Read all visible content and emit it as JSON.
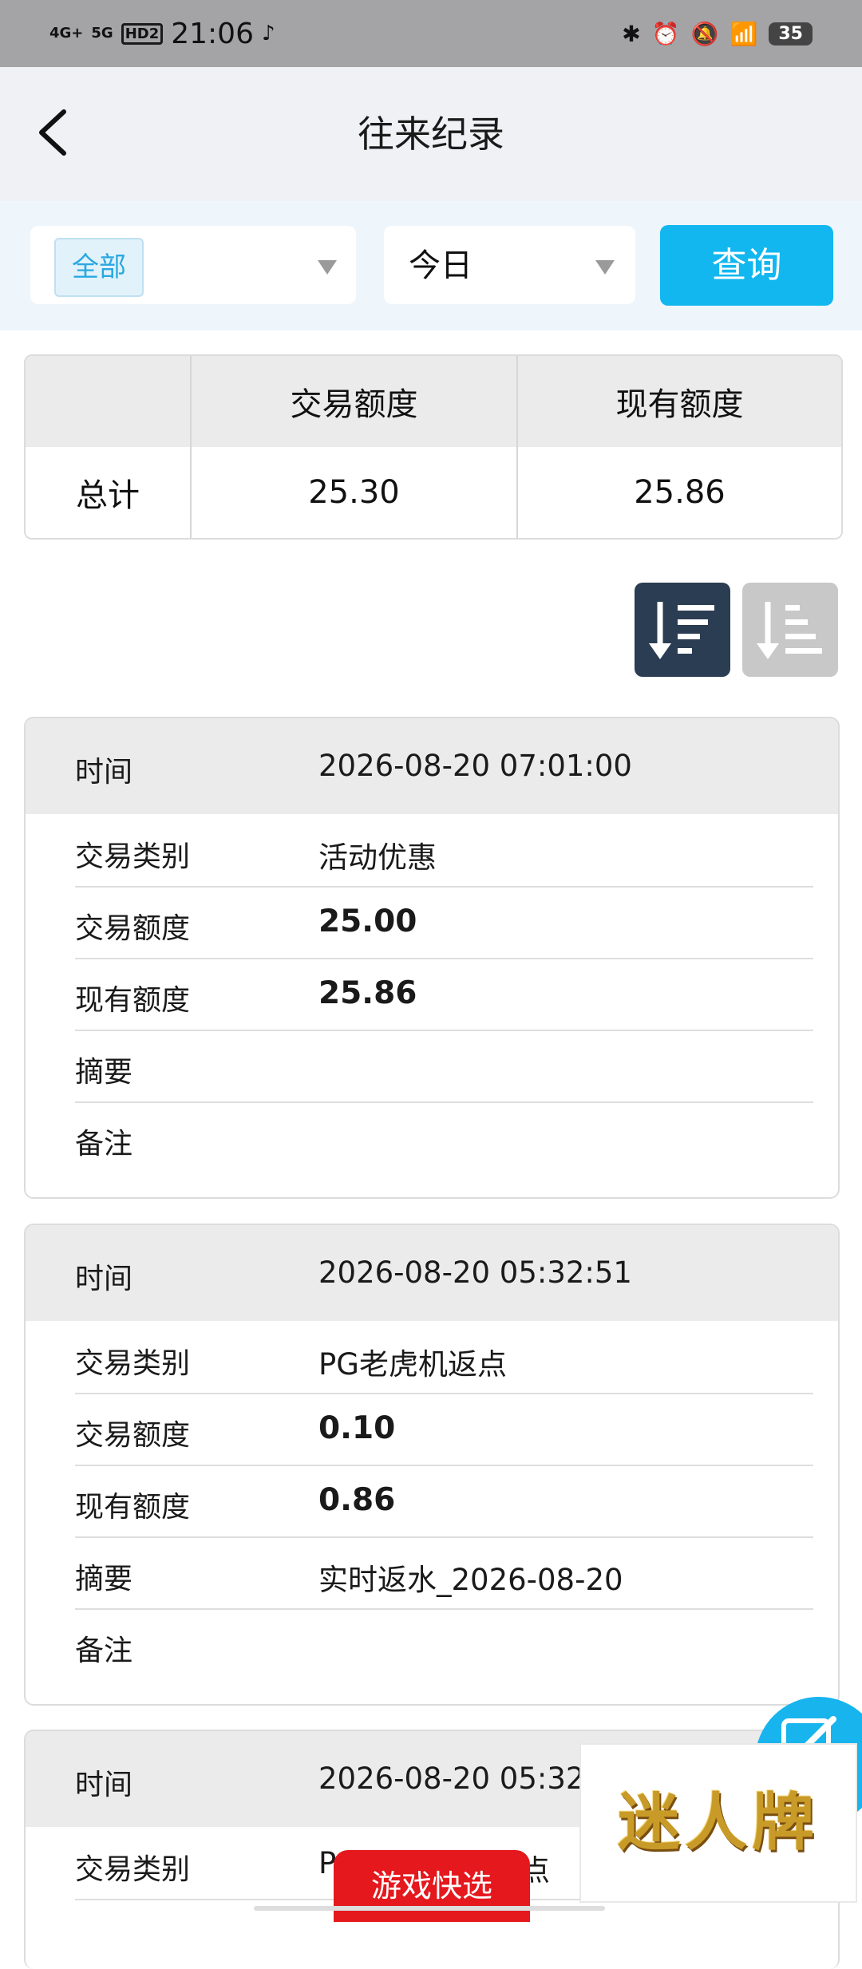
{
  "status_bar": {
    "signal_1": "4G+",
    "signal_2": "5G",
    "hd": "HD2",
    "time": "21:06",
    "battery": "35"
  },
  "header": {
    "title": "往来纪录",
    "back_icon": "chevron-left-icon"
  },
  "filters": {
    "type_selected": "全部",
    "period_selected": "今日",
    "query_label": "查询"
  },
  "summary": {
    "col_amount": "交易额度",
    "col_balance": "现有额度",
    "row_label": "总计",
    "total_amount": "25.30",
    "total_balance": "25.86"
  },
  "sort_buttons": {
    "desc_icon": "sort-descending-icon",
    "asc_icon": "sort-ascending-icon"
  },
  "labels": {
    "time": "时间",
    "type": "交易类别",
    "amount": "交易额度",
    "balance": "现有额度",
    "summary": "摘要",
    "note": "备注"
  },
  "records": [
    {
      "time": "2026-08-20 07:01:00",
      "type": "活动优惠",
      "amount": "25.00",
      "balance": "25.86",
      "summary": "",
      "note": ""
    },
    {
      "time": "2026-08-20 05:32:51",
      "type": "PG老虎机返点",
      "amount": "0.10",
      "balance": "0.86",
      "summary": "实时返水_2026-08-20",
      "note": ""
    },
    {
      "time": "2026-08-20 05:32",
      "type": "P",
      "type_tail": "点"
    }
  ],
  "overlays": {
    "brand_text": "迷人牌",
    "game_button": "游戏快选",
    "fab_icon": "edit-icon"
  },
  "colors": {
    "accent": "#12b7ef",
    "game_button": "#e4181d",
    "brand_gold": "#c89a28"
  }
}
